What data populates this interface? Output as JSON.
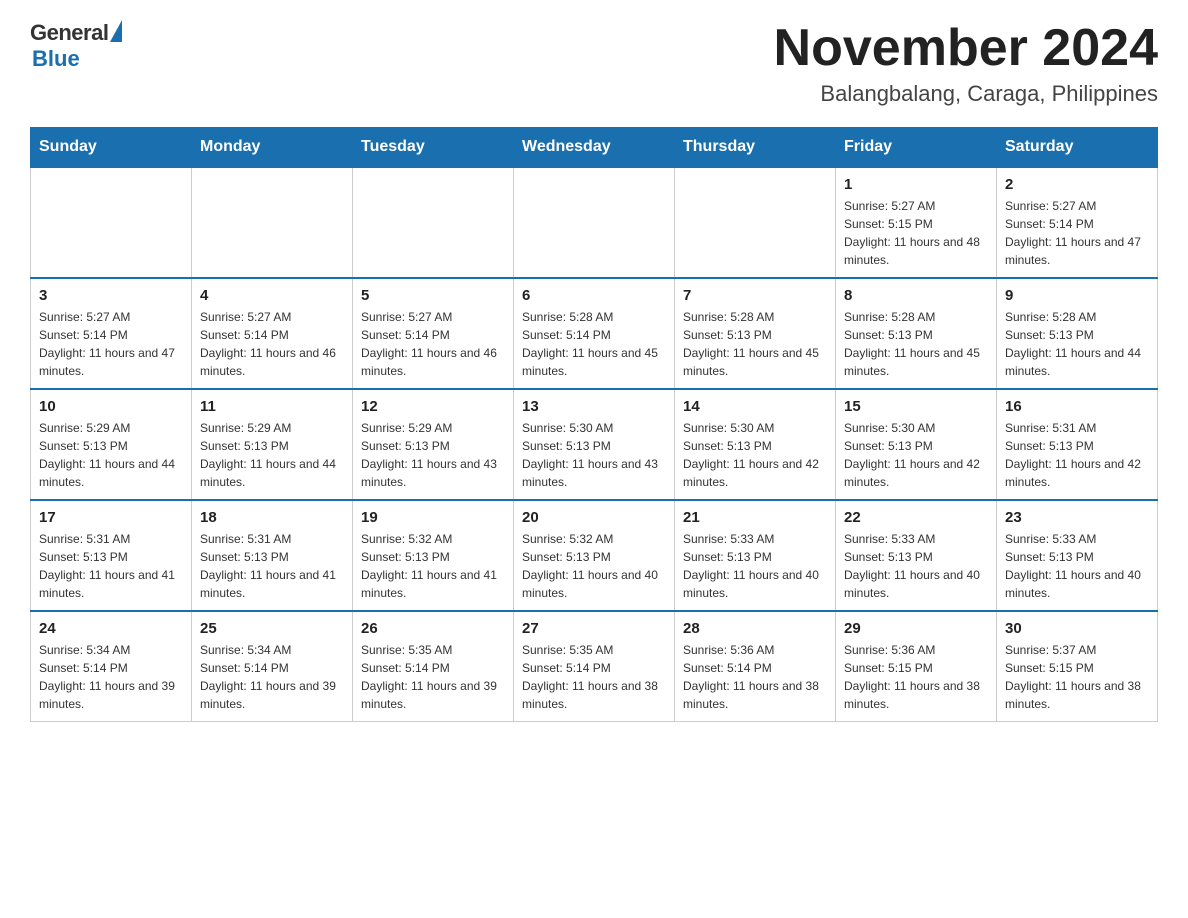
{
  "header": {
    "logo": {
      "general": "General",
      "blue": "Blue",
      "underline": "Blue"
    },
    "title": "November 2024",
    "location": "Balangbalang, Caraga, Philippines"
  },
  "days_of_week": [
    "Sunday",
    "Monday",
    "Tuesday",
    "Wednesday",
    "Thursday",
    "Friday",
    "Saturday"
  ],
  "weeks": [
    [
      {
        "day": "",
        "empty": true
      },
      {
        "day": "",
        "empty": true
      },
      {
        "day": "",
        "empty": true
      },
      {
        "day": "",
        "empty": true
      },
      {
        "day": "",
        "empty": true
      },
      {
        "day": "1",
        "sunrise": "Sunrise: 5:27 AM",
        "sunset": "Sunset: 5:15 PM",
        "daylight": "Daylight: 11 hours and 48 minutes."
      },
      {
        "day": "2",
        "sunrise": "Sunrise: 5:27 AM",
        "sunset": "Sunset: 5:14 PM",
        "daylight": "Daylight: 11 hours and 47 minutes."
      }
    ],
    [
      {
        "day": "3",
        "sunrise": "Sunrise: 5:27 AM",
        "sunset": "Sunset: 5:14 PM",
        "daylight": "Daylight: 11 hours and 47 minutes."
      },
      {
        "day": "4",
        "sunrise": "Sunrise: 5:27 AM",
        "sunset": "Sunset: 5:14 PM",
        "daylight": "Daylight: 11 hours and 46 minutes."
      },
      {
        "day": "5",
        "sunrise": "Sunrise: 5:27 AM",
        "sunset": "Sunset: 5:14 PM",
        "daylight": "Daylight: 11 hours and 46 minutes."
      },
      {
        "day": "6",
        "sunrise": "Sunrise: 5:28 AM",
        "sunset": "Sunset: 5:14 PM",
        "daylight": "Daylight: 11 hours and 45 minutes."
      },
      {
        "day": "7",
        "sunrise": "Sunrise: 5:28 AM",
        "sunset": "Sunset: 5:13 PM",
        "daylight": "Daylight: 11 hours and 45 minutes."
      },
      {
        "day": "8",
        "sunrise": "Sunrise: 5:28 AM",
        "sunset": "Sunset: 5:13 PM",
        "daylight": "Daylight: 11 hours and 45 minutes."
      },
      {
        "day": "9",
        "sunrise": "Sunrise: 5:28 AM",
        "sunset": "Sunset: 5:13 PM",
        "daylight": "Daylight: 11 hours and 44 minutes."
      }
    ],
    [
      {
        "day": "10",
        "sunrise": "Sunrise: 5:29 AM",
        "sunset": "Sunset: 5:13 PM",
        "daylight": "Daylight: 11 hours and 44 minutes."
      },
      {
        "day": "11",
        "sunrise": "Sunrise: 5:29 AM",
        "sunset": "Sunset: 5:13 PM",
        "daylight": "Daylight: 11 hours and 44 minutes."
      },
      {
        "day": "12",
        "sunrise": "Sunrise: 5:29 AM",
        "sunset": "Sunset: 5:13 PM",
        "daylight": "Daylight: 11 hours and 43 minutes."
      },
      {
        "day": "13",
        "sunrise": "Sunrise: 5:30 AM",
        "sunset": "Sunset: 5:13 PM",
        "daylight": "Daylight: 11 hours and 43 minutes."
      },
      {
        "day": "14",
        "sunrise": "Sunrise: 5:30 AM",
        "sunset": "Sunset: 5:13 PM",
        "daylight": "Daylight: 11 hours and 42 minutes."
      },
      {
        "day": "15",
        "sunrise": "Sunrise: 5:30 AM",
        "sunset": "Sunset: 5:13 PM",
        "daylight": "Daylight: 11 hours and 42 minutes."
      },
      {
        "day": "16",
        "sunrise": "Sunrise: 5:31 AM",
        "sunset": "Sunset: 5:13 PM",
        "daylight": "Daylight: 11 hours and 42 minutes."
      }
    ],
    [
      {
        "day": "17",
        "sunrise": "Sunrise: 5:31 AM",
        "sunset": "Sunset: 5:13 PM",
        "daylight": "Daylight: 11 hours and 41 minutes."
      },
      {
        "day": "18",
        "sunrise": "Sunrise: 5:31 AM",
        "sunset": "Sunset: 5:13 PM",
        "daylight": "Daylight: 11 hours and 41 minutes."
      },
      {
        "day": "19",
        "sunrise": "Sunrise: 5:32 AM",
        "sunset": "Sunset: 5:13 PM",
        "daylight": "Daylight: 11 hours and 41 minutes."
      },
      {
        "day": "20",
        "sunrise": "Sunrise: 5:32 AM",
        "sunset": "Sunset: 5:13 PM",
        "daylight": "Daylight: 11 hours and 40 minutes."
      },
      {
        "day": "21",
        "sunrise": "Sunrise: 5:33 AM",
        "sunset": "Sunset: 5:13 PM",
        "daylight": "Daylight: 11 hours and 40 minutes."
      },
      {
        "day": "22",
        "sunrise": "Sunrise: 5:33 AM",
        "sunset": "Sunset: 5:13 PM",
        "daylight": "Daylight: 11 hours and 40 minutes."
      },
      {
        "day": "23",
        "sunrise": "Sunrise: 5:33 AM",
        "sunset": "Sunset: 5:13 PM",
        "daylight": "Daylight: 11 hours and 40 minutes."
      }
    ],
    [
      {
        "day": "24",
        "sunrise": "Sunrise: 5:34 AM",
        "sunset": "Sunset: 5:14 PM",
        "daylight": "Daylight: 11 hours and 39 minutes."
      },
      {
        "day": "25",
        "sunrise": "Sunrise: 5:34 AM",
        "sunset": "Sunset: 5:14 PM",
        "daylight": "Daylight: 11 hours and 39 minutes."
      },
      {
        "day": "26",
        "sunrise": "Sunrise: 5:35 AM",
        "sunset": "Sunset: 5:14 PM",
        "daylight": "Daylight: 11 hours and 39 minutes."
      },
      {
        "day": "27",
        "sunrise": "Sunrise: 5:35 AM",
        "sunset": "Sunset: 5:14 PM",
        "daylight": "Daylight: 11 hours and 38 minutes."
      },
      {
        "day": "28",
        "sunrise": "Sunrise: 5:36 AM",
        "sunset": "Sunset: 5:14 PM",
        "daylight": "Daylight: 11 hours and 38 minutes."
      },
      {
        "day": "29",
        "sunrise": "Sunrise: 5:36 AM",
        "sunset": "Sunset: 5:15 PM",
        "daylight": "Daylight: 11 hours and 38 minutes."
      },
      {
        "day": "30",
        "sunrise": "Sunrise: 5:37 AM",
        "sunset": "Sunset: 5:15 PM",
        "daylight": "Daylight: 11 hours and 38 minutes."
      }
    ]
  ]
}
